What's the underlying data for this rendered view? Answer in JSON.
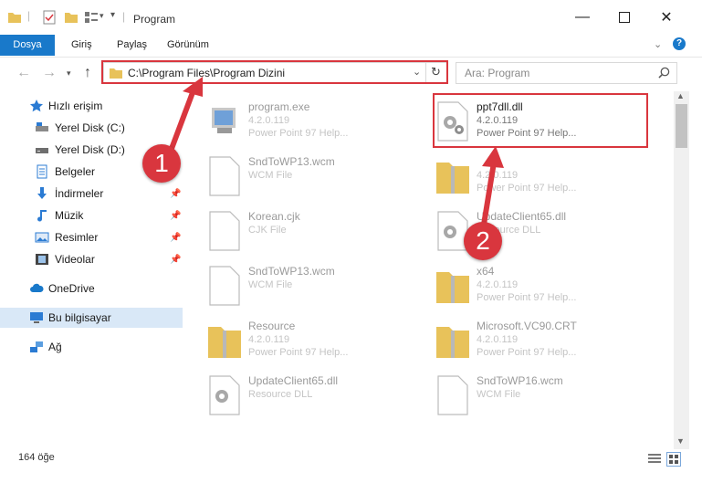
{
  "window": {
    "title": "Program"
  },
  "ribbon": {
    "tabs": [
      "Dosya",
      "Giriş",
      "Paylaş",
      "Görünüm"
    ]
  },
  "address": {
    "path": "C:\\Program Files\\Program Dizini"
  },
  "search": {
    "placeholder": "Ara: Program"
  },
  "sidebar": {
    "quick_access": "Hızlı erişim",
    "items": [
      "Yerel Disk (C:)",
      "Yerel Disk (D:)",
      "Belgeler",
      "İndirmeler",
      "Müzik",
      "Resimler",
      "Videolar"
    ],
    "onedrive": "OneDrive",
    "this_pc": "Bu bilgisayar",
    "network": "Ağ"
  },
  "files": [
    {
      "name": "program.exe",
      "line2": "4.2.0.119",
      "line3": "Power Point 97 Help..."
    },
    {
      "name": "ppt7dll.dll",
      "line2": "4.2.0.119",
      "line3": "Power Point 97 Help..."
    },
    {
      "name": "SndToWP13.wcm",
      "line2": "WCM File",
      "line3": ""
    },
    {
      "name": "",
      "line2": "4.2.0.119",
      "line3": "Power Point 97 Help..."
    },
    {
      "name": "Korean.cjk",
      "line2": "CJK File",
      "line3": ""
    },
    {
      "name": "UpdateClient65.dll",
      "line2": "Resource DLL",
      "line3": ""
    },
    {
      "name": "SndToWP13.wcm",
      "line2": "WCM File",
      "line3": ""
    },
    {
      "name": "x64",
      "line2": "4.2.0.119",
      "line3": "Power Point 97 Help..."
    },
    {
      "name": "Resource",
      "line2": "4.2.0.119",
      "line3": "Power Point 97 Help..."
    },
    {
      "name": "Microsoft.VC90.CRT",
      "line2": "4.2.0.119",
      "line3": "Power Point 97 Help..."
    },
    {
      "name": "UpdateClient65.dll",
      "line2": "Resource DLL",
      "line3": ""
    },
    {
      "name": "SndToWP16.wcm",
      "line2": "WCM File",
      "line3": ""
    }
  ],
  "status": {
    "count": "164 öğe"
  },
  "annotations": {
    "badge1": "1",
    "badge2": "2"
  },
  "colors": {
    "accent": "#1979ca",
    "annotation": "#d9363e"
  }
}
